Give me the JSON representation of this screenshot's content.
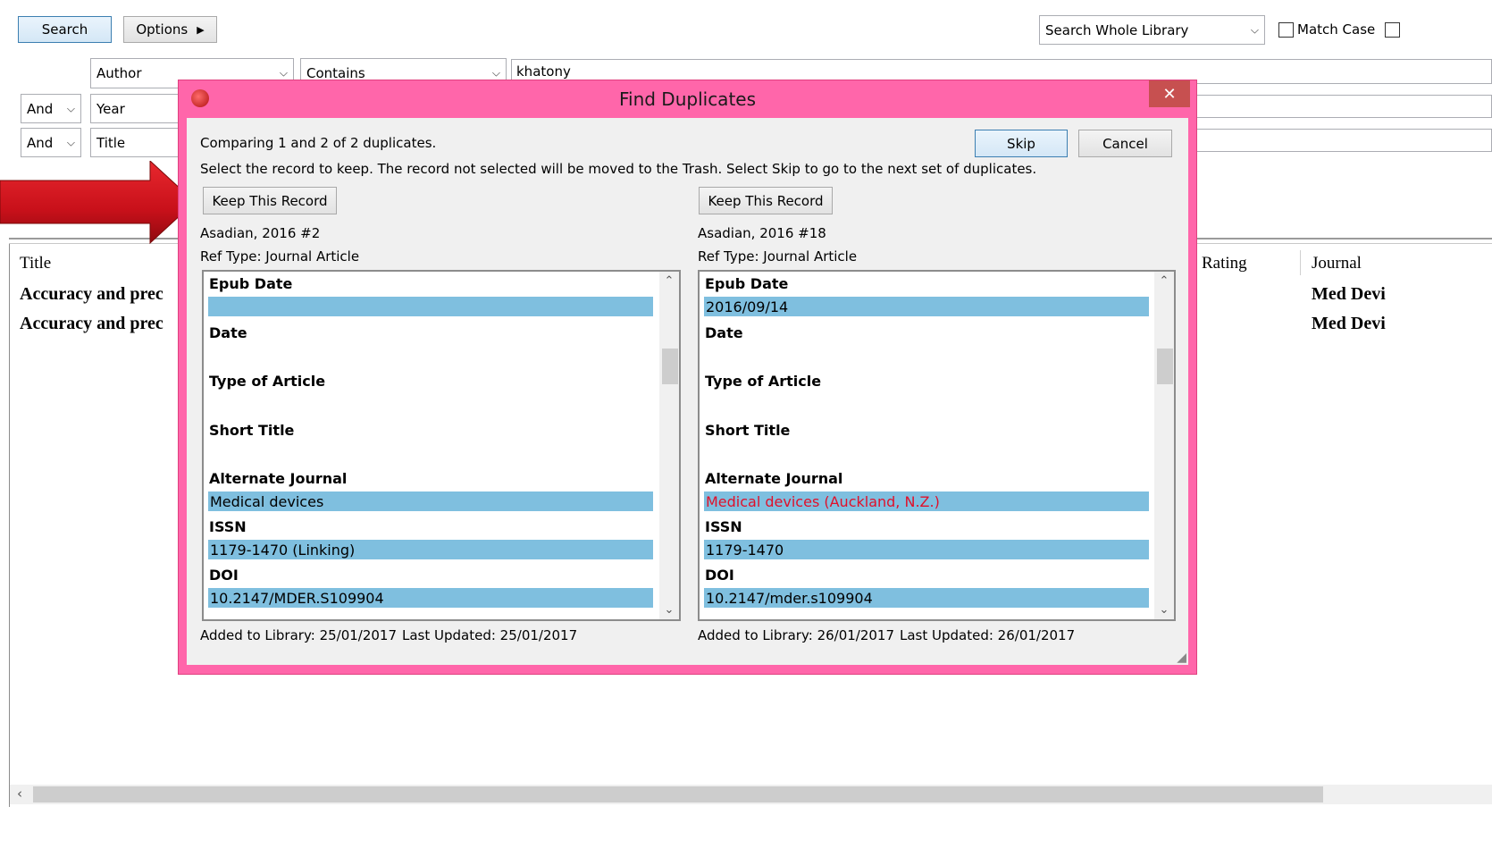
{
  "search_panel": {
    "search_button": "Search",
    "options_button": "Options",
    "scope_select": "Search Whole Library",
    "match_case_label": "Match Case",
    "rows": [
      {
        "connector": "",
        "field": "Author",
        "operator": "Contains",
        "value": "khatony"
      },
      {
        "connector": "And",
        "field": "Year",
        "operator": "",
        "value": ""
      },
      {
        "connector": "And",
        "field": "Title",
        "operator": "",
        "value": ""
      }
    ]
  },
  "reference_list": {
    "columns": {
      "title": "Title",
      "rating": "Rating",
      "journal": "Journal"
    },
    "rows": [
      {
        "title": "Accuracy and prec",
        "journal": "Med Devi"
      },
      {
        "title": "Accuracy and prec",
        "journal": "Med Devi"
      }
    ]
  },
  "dialog": {
    "title": "Find Duplicates",
    "close_glyph": "✕",
    "comparing_text": "Comparing 1 and 2 of 2 duplicates.",
    "instruction_text": "Select the record to keep. The record not selected will be moved to the Trash. Select Skip to go to the next set of duplicates.",
    "skip_button": "Skip",
    "cancel_button": "Cancel",
    "left": {
      "keep_button": "Keep This Record",
      "ref_label": "Asadian, 2016 #2",
      "ref_type": "Ref Type: Journal Article",
      "fields": {
        "epub_date_label": "Epub Date",
        "epub_date": "",
        "date_label": "Date",
        "type_label": "Type of Article",
        "short_title_label": "Short Title",
        "alt_journal_label": "Alternate Journal",
        "alt_journal": "Medical devices",
        "issn_label": "ISSN",
        "issn": "1179-1470 (Linking)",
        "doi_label": "DOI",
        "doi": "10.2147/MDER.S109904"
      },
      "added": "Added to Library: 25/01/2017",
      "updated": "Last Updated: 25/01/2017"
    },
    "right": {
      "keep_button": "Keep This Record",
      "ref_label": "Asadian, 2016 #18",
      "ref_type": "Ref Type: Journal Article",
      "fields": {
        "epub_date_label": "Epub Date",
        "epub_date": "2016/09/14",
        "date_label": "Date",
        "type_label": "Type of Article",
        "short_title_label": "Short Title",
        "alt_journal_label": "Alternate Journal",
        "alt_journal": "Medical devices (Auckland, N.Z.)",
        "issn_label": "ISSN",
        "issn": "1179-1470",
        "doi_label": "DOI",
        "doi": "10.2147/mder.s109904"
      },
      "added": "Added to Library: 26/01/2017",
      "updated": "Last Updated: 26/01/2017"
    }
  },
  "colors": {
    "dialog_frame": "#ff66aa",
    "field_highlight": "#7fbfdf",
    "difference_text": "#e0102a",
    "close_button": "#c75050",
    "arrow": "#c8101a"
  },
  "icons": [
    "chevron-down-icon",
    "triangle-right-icon",
    "close-icon",
    "app-icon",
    "scroll-up-icon",
    "scroll-down-icon",
    "scroll-left-icon",
    "red-arrow-icon"
  ]
}
